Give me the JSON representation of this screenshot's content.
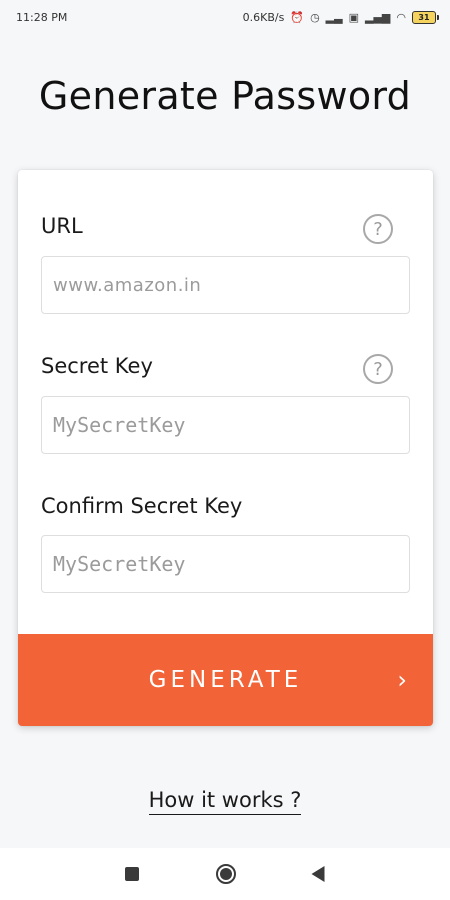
{
  "status_bar": {
    "time": "11:28 PM",
    "net_speed": "0.6KB/s",
    "battery": "31"
  },
  "page": {
    "title": "Generate Password"
  },
  "form": {
    "url": {
      "label": "URL",
      "placeholder": "www.amazon.in",
      "help": "?"
    },
    "secret_key": {
      "label": "Secret Key",
      "placeholder": "MySecretKey",
      "help": "?"
    },
    "confirm_secret_key": {
      "label": "Confirm Secret Key",
      "placeholder": "MySecretKey"
    },
    "generate_label": "GENERATE",
    "generate_chevron": "›"
  },
  "footer": {
    "how_it_works": "How it works ?"
  },
  "colors": {
    "accent": "#f26337",
    "background": "#f6f7f9"
  }
}
